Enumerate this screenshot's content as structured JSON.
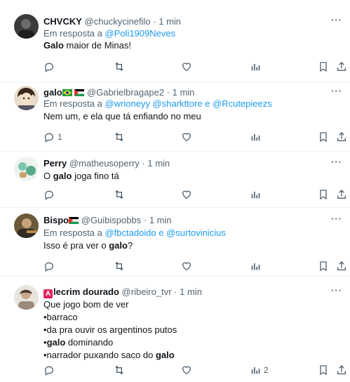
{
  "posts": [
    {
      "name": "CHVCKY",
      "handle": "@chuckycinefilo",
      "sep": "·",
      "time": "1 min",
      "reply_prefix": "Em resposta a",
      "reply_to": "@Poli1909Neves",
      "lines": [
        [
          {
            "t": "Galo",
            "b": true
          },
          {
            "t": " maior de Minas!"
          }
        ]
      ],
      "reply_count": "",
      "views_count": ""
    },
    {
      "name": "galo",
      "handle": "@Gabrielbragape2",
      "sep": "·",
      "time": "1 min",
      "reply_prefix": "Em resposta a",
      "reply_to": "@wrioneyy @sharkttore e @Rcutepieezs",
      "lines": [
        [
          {
            "t": "Nem um, e ela que tá enfiando no meu"
          }
        ]
      ],
      "reply_count": "1",
      "views_count": ""
    },
    {
      "name": "Perry",
      "handle": "@matheusoperry",
      "sep": "·",
      "time": "1 min",
      "lines": [
        [
          {
            "t": "O "
          },
          {
            "t": "galo",
            "b": true
          },
          {
            "t": " joga fino tá"
          }
        ]
      ],
      "reply_count": "",
      "views_count": ""
    },
    {
      "name": "Bispo",
      "handle": "@Guibispobbs",
      "sep": "·",
      "time": "1 min",
      "reply_prefix": "Em resposta a",
      "reply_to": "@fbctadoido e @surtovinicius",
      "lines": [
        [
          {
            "t": "Isso é pra ver o "
          },
          {
            "t": "galo",
            "b": true
          },
          {
            "t": "?"
          }
        ]
      ],
      "reply_count": "",
      "views_count": ""
    },
    {
      "name_badge": "A",
      "name": "lecrim dourado",
      "handle": "@ribeiro_tvr",
      "sep": "·",
      "time": "1 min",
      "lines": [
        [
          {
            "t": "Que jogo bom de ver"
          }
        ],
        [
          {
            "t": "•barraco"
          }
        ],
        [
          {
            "t": "•da pra ouvir os argentinos putos"
          }
        ],
        [
          {
            "t": "•"
          },
          {
            "t": "galo",
            "b": true
          },
          {
            "t": " dominando"
          }
        ],
        [
          {
            "t": "•narrador puxando saco do "
          },
          {
            "t": "galo",
            "b": true
          }
        ]
      ],
      "reply_count": "",
      "views_count": "2"
    }
  ],
  "more_icon_text": "···",
  "icons": {
    "reply": "reply-icon",
    "repost": "repost-icon",
    "like": "like-icon",
    "views": "views-icon",
    "bookmark": "bookmark-icon",
    "share": "share-icon"
  },
  "colors": {
    "link": "#1d9bf0",
    "secondary_text": "#536471",
    "divider": "#eff3f4",
    "badge": "#e0245e"
  }
}
